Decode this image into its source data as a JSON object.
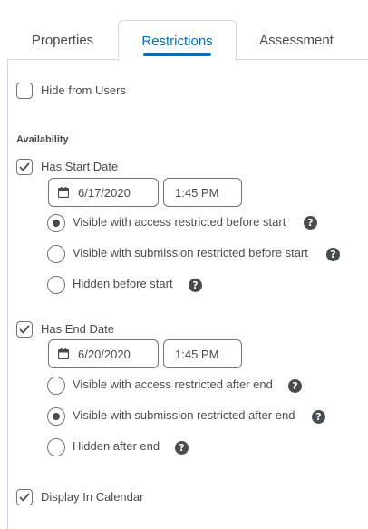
{
  "tabs": [
    {
      "label": "Properties"
    },
    {
      "label": "Restrictions"
    },
    {
      "label": "Assessment"
    }
  ],
  "hide_from_users": {
    "label": "Hide from Users",
    "checked": false
  },
  "availability": {
    "title": "Availability",
    "start": {
      "label": "Has Start Date",
      "checked": true,
      "date": "6/17/2020",
      "time": "1:45 PM",
      "options": [
        {
          "label": "Visible with access restricted before start",
          "checked": true
        },
        {
          "label": "Visible with submission restricted before start",
          "checked": false
        },
        {
          "label": "Hidden before start",
          "checked": false
        }
      ]
    },
    "end": {
      "label": "Has End Date",
      "checked": true,
      "date": "6/20/2020",
      "time": "1:45 PM",
      "options": [
        {
          "label": "Visible with access restricted after end",
          "checked": false
        },
        {
          "label": "Visible with submission restricted after end",
          "checked": true
        },
        {
          "label": "Hidden after end",
          "checked": false
        }
      ]
    }
  },
  "display_in_calendar": {
    "label": "Display In Calendar",
    "checked": true
  },
  "help_glyph": "?",
  "icons": {
    "checkmark": "checkmark-icon",
    "calendar": "calendar-icon",
    "help": "help-icon"
  }
}
